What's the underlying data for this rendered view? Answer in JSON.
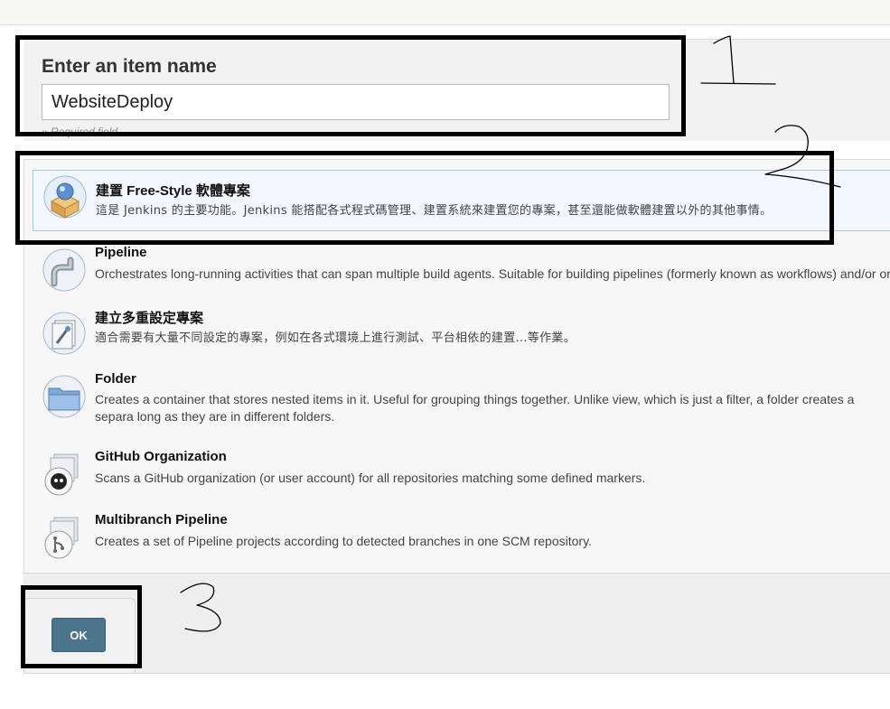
{
  "form": {
    "name_label": "Enter an item name",
    "name_value": "WebsiteDeploy",
    "required_note": "» Required field"
  },
  "items": [
    {
      "title": "建置 Free-Style 軟體專案",
      "desc": "這是 Jenkins 的主要功能。Jenkins 能搭配各式程式碼管理、建置系統來建置您的專案，甚至還能做軟體建置以外的其他事情。",
      "icon": "freestyle-box-icon",
      "selected": true
    },
    {
      "title": "Pipeline",
      "desc": "Orchestrates long-running activities that can span multiple build agents. Suitable for building pipelines (formerly known as workflows) and/or or",
      "icon": "pipeline-pipe-icon"
    },
    {
      "title": "建立多重設定專案",
      "desc": "適合需要有大量不同設定的專案，例如在各式環境上進行測試、平台相依的建置...等作業。",
      "icon": "multi-configuration-icon"
    },
    {
      "title": "Folder",
      "desc": "Creates a container that stores nested items in it. Useful for grouping things together. Unlike view, which is just a filter, a folder creates a separa long as they are in different folders.",
      "icon": "folder-icon"
    },
    {
      "title": "GitHub Organization",
      "desc": "Scans a GitHub organization (or user account) for all repositories matching some defined markers.",
      "icon": "github-octocat-icon"
    },
    {
      "title": "Multibranch Pipeline",
      "desc": "Creates a set of Pipeline projects according to detected branches in one SCM repository.",
      "icon": "multibranch-icon"
    }
  ],
  "ok_label": "OK",
  "colors": {
    "ok_button": "#4b758b",
    "selected_item_bg": "#f3f8ff",
    "annotation": "#000000"
  }
}
